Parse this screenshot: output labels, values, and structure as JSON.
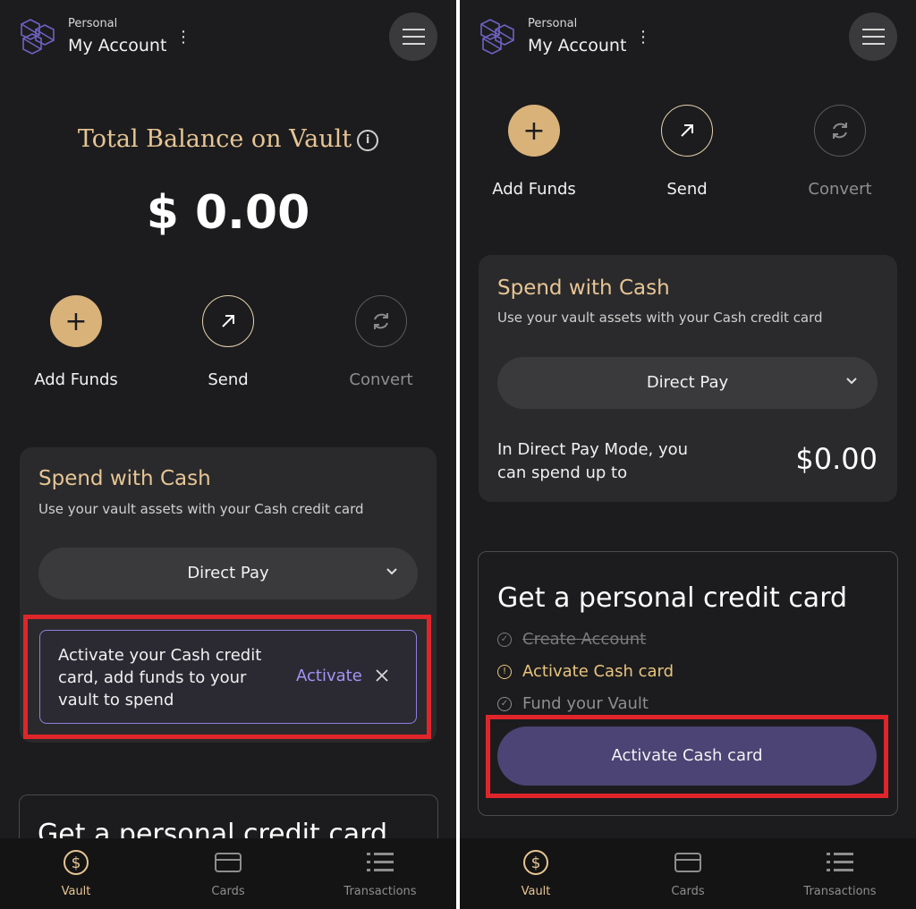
{
  "header": {
    "account_type": "Personal",
    "account_name": "My Account"
  },
  "balance": {
    "title": "Total Balance on Vault",
    "amount": "$ 0.00"
  },
  "actions": {
    "add_funds": "Add Funds",
    "send": "Send",
    "convert": "Convert"
  },
  "spend": {
    "title": "Spend with Cash",
    "subtitle": "Use your vault assets with your Cash credit card",
    "mode": "Direct Pay",
    "limit_text": "In Direct Pay Mode, you can spend up to",
    "limit_value": "$0.00"
  },
  "notice": {
    "text": "Activate your Cash credit card, add funds to your vault to spend",
    "action": "Activate"
  },
  "credit_card": {
    "title": "Get a personal credit card",
    "steps": [
      {
        "label": "Create Account",
        "state": "done"
      },
      {
        "label": "Activate Cash card",
        "state": "current"
      },
      {
        "label": "Fund your Vault",
        "state": "pending"
      }
    ],
    "cta": "Activate Cash card"
  },
  "tabs": [
    {
      "label": "Vault",
      "icon": "dollar-circle-icon",
      "active": true
    },
    {
      "label": "Cards",
      "icon": "card-icon",
      "active": false
    },
    {
      "label": "Transactions",
      "icon": "list-icon",
      "active": false
    }
  ],
  "colors": {
    "background": "#1c1c1e",
    "gold": "#e7c594",
    "accent": "#8f7ee0",
    "highlight": "#e0252a"
  }
}
